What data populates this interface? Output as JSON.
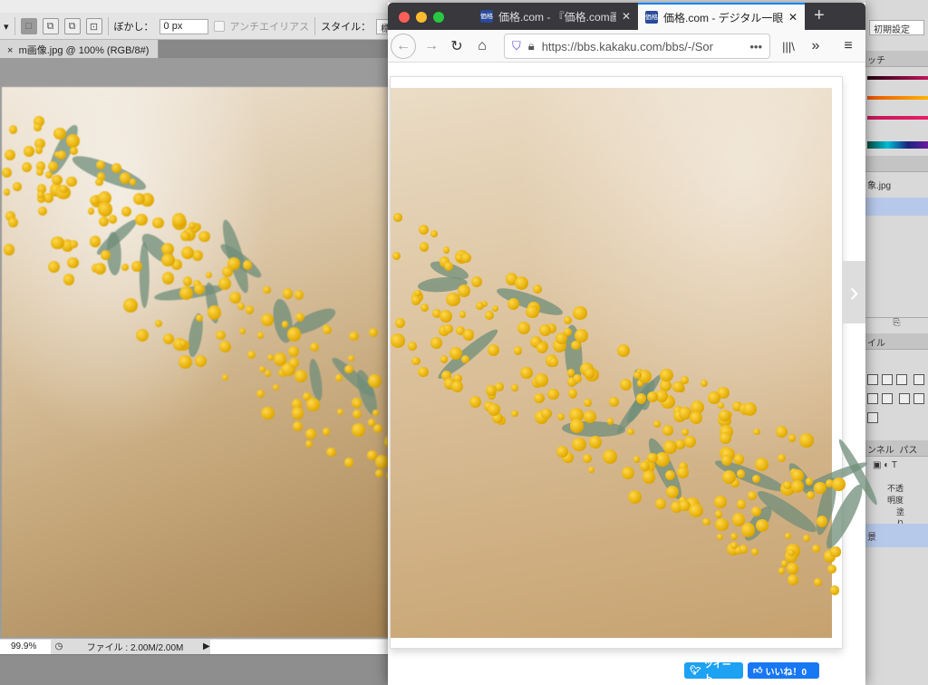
{
  "photoshop": {
    "options": {
      "feather_label": "ぼかし：",
      "feather_value": "0 px",
      "antialias_label": "アンチエイリアス",
      "style_label": "スタイル：",
      "style_value": "標準",
      "workspace": "初期設定"
    },
    "doc_tab": {
      "close": "×",
      "title": "m画像.jpg @ 100% (RGB/8#)"
    },
    "status": {
      "zoom": "99.9%",
      "file": "ファイル : 2.00M/2.00M"
    },
    "panels": {
      "swatches_tab": "ッチ",
      "history_file": "象.jpg",
      "styles_tab": "イル",
      "channels_tab": "ンネル",
      "paths_tab": "パス",
      "opacity_label": "不透明度",
      "fill_label": "塗り",
      "layer_name": "景"
    },
    "swatch_colors": [
      "#c2185b",
      "#ff8f00",
      "#e91e63",
      "#00897b"
    ]
  },
  "browser": {
    "tabs": [
      {
        "favicon": "価格",
        "title": "価格.com - 『価格.com画像ア"
      },
      {
        "favicon": "価格",
        "title": "価格.com - デジタル一眼カメ"
      }
    ],
    "url": "https://bbs.kakaku.com/bbs/-/Sor",
    "tweet_label": "ツイート",
    "like_label": "いいね！0"
  }
}
